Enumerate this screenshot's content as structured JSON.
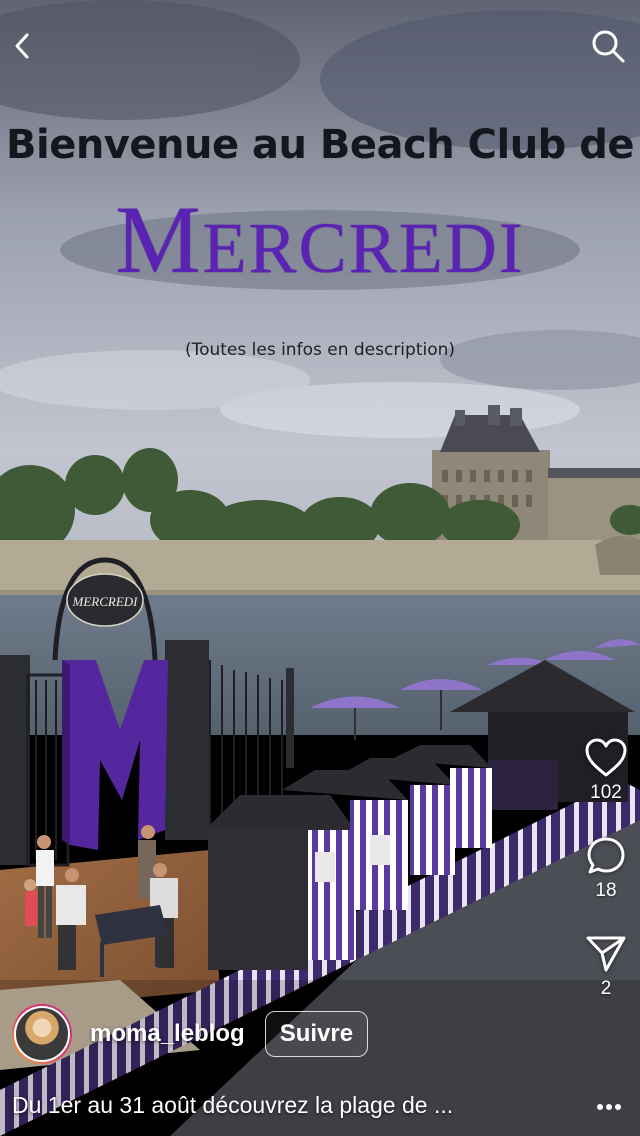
{
  "overlay": {
    "headline": "Bienvenue au Beach Club de",
    "brand_first": "M",
    "brand_rest": "ERCREDI",
    "subnote": "(Toutes les infos en description)"
  },
  "scene": {
    "gate_sign": "MERCREDI",
    "gate_letter": "M"
  },
  "icons": {
    "back": "chevron-left-icon",
    "search": "search-icon",
    "like": "heart-icon",
    "comment": "comment-icon",
    "share": "send-icon",
    "more": "more-icon"
  },
  "actions": {
    "likes": "102",
    "comments": "18",
    "shares": "2"
  },
  "author": {
    "username": "moma_leblog",
    "follow_label": "Suivre"
  },
  "caption": "Du 1er au 31 août découvrez la plage de ...",
  "colors": {
    "brand_purple": "#5a23b3",
    "sky": "#9ea3b3",
    "river": "#6a7685"
  }
}
